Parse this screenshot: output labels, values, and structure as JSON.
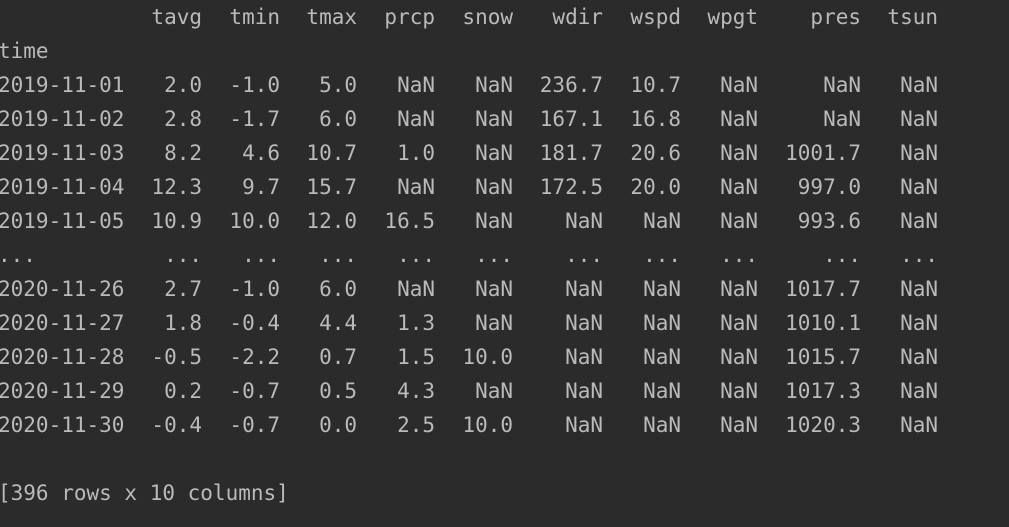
{
  "columns": [
    "tavg",
    "tmin",
    "tmax",
    "prcp",
    "snow",
    "wdir",
    "wspd",
    "wpgt",
    "pres",
    "tsun"
  ],
  "index_name": "time",
  "rows": [
    {
      "index": "2019-11-01",
      "values": [
        "2.0",
        "-1.0",
        "5.0",
        "NaN",
        "NaN",
        "236.7",
        "10.7",
        "NaN",
        "NaN",
        "NaN"
      ]
    },
    {
      "index": "2019-11-02",
      "values": [
        "2.8",
        "-1.7",
        "6.0",
        "NaN",
        "NaN",
        "167.1",
        "16.8",
        "NaN",
        "NaN",
        "NaN"
      ]
    },
    {
      "index": "2019-11-03",
      "values": [
        "8.2",
        "4.6",
        "10.7",
        "1.0",
        "NaN",
        "181.7",
        "20.6",
        "NaN",
        "1001.7",
        "NaN"
      ]
    },
    {
      "index": "2019-11-04",
      "values": [
        "12.3",
        "9.7",
        "15.7",
        "NaN",
        "NaN",
        "172.5",
        "20.0",
        "NaN",
        "997.0",
        "NaN"
      ]
    },
    {
      "index": "2019-11-05",
      "values": [
        "10.9",
        "10.0",
        "12.0",
        "16.5",
        "NaN",
        "NaN",
        "NaN",
        "NaN",
        "993.6",
        "NaN"
      ]
    },
    {
      "index": "...",
      "values": [
        "...",
        "...",
        "...",
        "...",
        "...",
        "...",
        "...",
        "...",
        "...",
        "..."
      ]
    },
    {
      "index": "2020-11-26",
      "values": [
        "2.7",
        "-1.0",
        "6.0",
        "NaN",
        "NaN",
        "NaN",
        "NaN",
        "NaN",
        "1017.7",
        "NaN"
      ]
    },
    {
      "index": "2020-11-27",
      "values": [
        "1.8",
        "-0.4",
        "4.4",
        "1.3",
        "NaN",
        "NaN",
        "NaN",
        "NaN",
        "1010.1",
        "NaN"
      ]
    },
    {
      "index": "2020-11-28",
      "values": [
        "-0.5",
        "-2.2",
        "0.7",
        "1.5",
        "10.0",
        "NaN",
        "NaN",
        "NaN",
        "1015.7",
        "NaN"
      ]
    },
    {
      "index": "2020-11-29",
      "values": [
        "0.2",
        "-0.7",
        "0.5",
        "4.3",
        "NaN",
        "NaN",
        "NaN",
        "NaN",
        "1017.3",
        "NaN"
      ]
    },
    {
      "index": "2020-11-30",
      "values": [
        "-0.4",
        "-0.7",
        "0.0",
        "2.5",
        "10.0",
        "NaN",
        "NaN",
        "NaN",
        "1020.3",
        "NaN"
      ]
    }
  ],
  "footer": "[396 rows x 10 columns]",
  "colors": {
    "background": "#2b2b2b",
    "text": "#bababa"
  }
}
